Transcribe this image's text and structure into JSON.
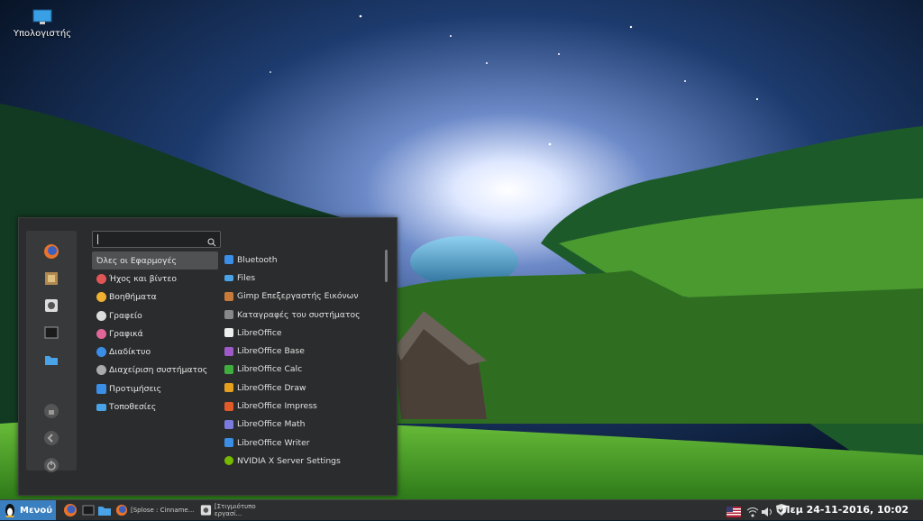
{
  "desktop": {
    "icon_label": "Υπολογιστής"
  },
  "menu": {
    "search_placeholder": "",
    "categories": [
      {
        "label": "Όλες οι Εφαρμογές",
        "color": "#505152"
      },
      {
        "label": "Ήχος και βίντεο",
        "color": "#e05555"
      },
      {
        "label": "Βοηθήματα",
        "color": "#f0b030"
      },
      {
        "label": "Γραφείο",
        "color": "#dddddd"
      },
      {
        "label": "Γραφικά",
        "color": "#e06699"
      },
      {
        "label": "Διαδίκτυο",
        "color": "#3a8ee6"
      },
      {
        "label": "Διαχείριση συστήματος",
        "color": "#aaaaaa"
      },
      {
        "label": "Προτιμήσεις",
        "color": "#3a8ee6"
      },
      {
        "label": "Τοποθεσίες",
        "color": "#4aa3e6"
      }
    ],
    "apps": [
      {
        "label": "Bluetooth",
        "color": "#3a8ee6"
      },
      {
        "label": "Files",
        "color": "#4aa3e6"
      },
      {
        "label": "Gimp Επεξεργαστής Εικόνων",
        "color": "#c87a3a"
      },
      {
        "label": "Καταγραφές του συστήματος",
        "color": "#888888"
      },
      {
        "label": "LibreOffice",
        "color": "#eeeeee"
      },
      {
        "label": "LibreOffice Base",
        "color": "#a05ac8"
      },
      {
        "label": "LibreOffice Calc",
        "color": "#3fae3f"
      },
      {
        "label": "LibreOffice Draw",
        "color": "#e6a020"
      },
      {
        "label": "LibreOffice Impress",
        "color": "#e05a2a"
      },
      {
        "label": "LibreOffice Math",
        "color": "#7a7adf"
      },
      {
        "label": "LibreOffice Writer",
        "color": "#3a8ee6"
      },
      {
        "label": "NVIDIA X Server Settings",
        "color": "#76b900"
      }
    ]
  },
  "taskbar": {
    "menu_label": "Μενού",
    "task1": "[Splose : Cinname...",
    "task2": "[Στιγμιότυπο εργασί...",
    "clock": "Πεμ 24-11-2016, 10:02"
  }
}
